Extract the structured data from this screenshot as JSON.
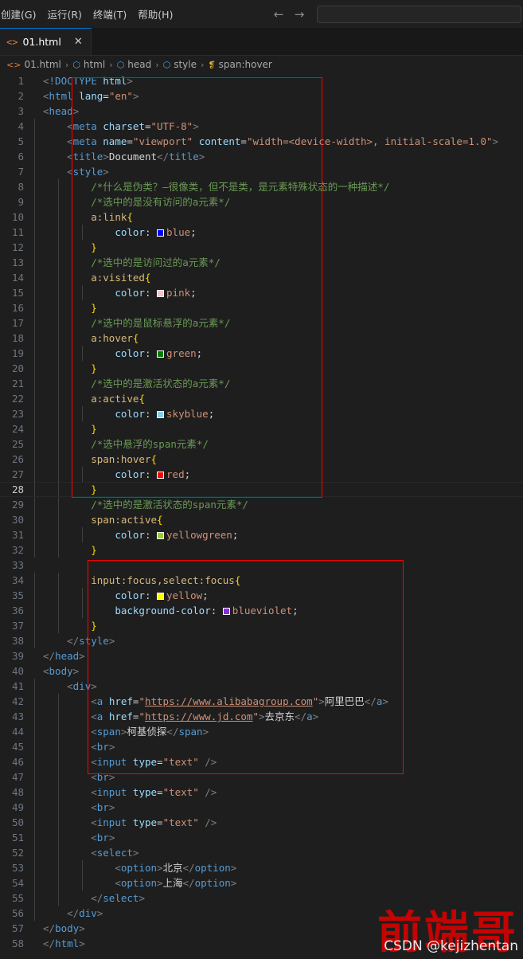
{
  "window": {
    "menu_items": [
      "创建(G)",
      "运行(R)",
      "终端(T)",
      "帮助(H)"
    ],
    "nav_back": "←",
    "nav_forward": "→",
    "search_placeholder": "",
    "search_value": ""
  },
  "tab": {
    "file_icon": "<>",
    "label": "01.html",
    "close": "✕"
  },
  "breadcrumb": {
    "items": [
      {
        "icon": "html-file-icon",
        "glyph": "<>",
        "label": "01.html"
      },
      {
        "icon": "cube-icon",
        "glyph": "⬡",
        "label": "html"
      },
      {
        "icon": "cube-icon",
        "glyph": "⬡",
        "label": "head"
      },
      {
        "icon": "cube-icon",
        "glyph": "⬡",
        "label": "style"
      },
      {
        "icon": "css-rule-icon",
        "glyph": "❡",
        "label": "span:hover"
      }
    ],
    "separator": "›"
  },
  "editor": {
    "active_line": 28,
    "colors": {
      "comment": "#6a9955",
      "tag": "#569cd6",
      "attribute": "#9cdcfe",
      "string": "#ce9178",
      "selector": "#d7ba7d",
      "brace": "#ffd700",
      "annotation_box": "#ff0000",
      "background": "#1e1e1e"
    },
    "lines": [
      {
        "n": 1,
        "text": "<!DOCTYPE html>"
      },
      {
        "n": 2,
        "text": "<html lang=\"en\">"
      },
      {
        "n": 3,
        "text": "<head>"
      },
      {
        "n": 4,
        "text": "    <meta charset=\"UTF-8\">"
      },
      {
        "n": 5,
        "text": "    <meta name=\"viewport\" content=\"width=<device-width>, initial-scale=1.0\">"
      },
      {
        "n": 6,
        "text": "    <title>Document</title>"
      },
      {
        "n": 7,
        "text": "    <style>"
      },
      {
        "n": 8,
        "text": "        /*什么是伪类？—很像类，但不是类，是元素特殊状态的一种描述*/"
      },
      {
        "n": 9,
        "text": "        /*选中的是没有访问的a元素*/"
      },
      {
        "n": 10,
        "text": "        a:link{"
      },
      {
        "n": 11,
        "text": "            color: blue;"
      },
      {
        "n": 12,
        "text": "        }"
      },
      {
        "n": 13,
        "text": "        /*选中的是访问过的a元素*/"
      },
      {
        "n": 14,
        "text": "        a:visited{"
      },
      {
        "n": 15,
        "text": "            color: pink;"
      },
      {
        "n": 16,
        "text": "        }"
      },
      {
        "n": 17,
        "text": "        /*选中的是鼠标悬浮的a元素*/"
      },
      {
        "n": 18,
        "text": "        a:hover{"
      },
      {
        "n": 19,
        "text": "            color: green;"
      },
      {
        "n": 20,
        "text": "        }"
      },
      {
        "n": 21,
        "text": "        /*选中的是激活状态的a元素*/"
      },
      {
        "n": 22,
        "text": "        a:active{"
      },
      {
        "n": 23,
        "text": "            color: skyblue;"
      },
      {
        "n": 24,
        "text": "        }"
      },
      {
        "n": 25,
        "text": "        /*选中悬浮的span元素*/"
      },
      {
        "n": 26,
        "text": "        span:hover{"
      },
      {
        "n": 27,
        "text": "            color: red;"
      },
      {
        "n": 28,
        "text": "        }"
      },
      {
        "n": 29,
        "text": "        /*选中的是激活状态的span元素*/"
      },
      {
        "n": 30,
        "text": "        span:active{"
      },
      {
        "n": 31,
        "text": "            color: yellowgreen;"
      },
      {
        "n": 32,
        "text": "        }"
      },
      {
        "n": 33,
        "text": ""
      },
      {
        "n": 34,
        "text": "        input:focus,select:focus{"
      },
      {
        "n": 35,
        "text": "            color: yellow;"
      },
      {
        "n": 36,
        "text": "            background-color: blueviolet;"
      },
      {
        "n": 37,
        "text": "        }"
      },
      {
        "n": 38,
        "text": "    </style>"
      },
      {
        "n": 39,
        "text": "</head>"
      },
      {
        "n": 40,
        "text": "<body>"
      },
      {
        "n": 41,
        "text": "    <div>"
      },
      {
        "n": 42,
        "text": "        <a href=\"https://www.alibabagroup.com\">阿里巴巴</a>"
      },
      {
        "n": 43,
        "text": "        <a href=\"https://www.jd.com\">去京东</a>"
      },
      {
        "n": 44,
        "text": "        <span>柯基侦探</span>"
      },
      {
        "n": 45,
        "text": "        <br>"
      },
      {
        "n": 46,
        "text": "        <input type=\"text\" />"
      },
      {
        "n": 47,
        "text": "        <br>"
      },
      {
        "n": 48,
        "text": "        <input type=\"text\" />"
      },
      {
        "n": 49,
        "text": "        <br>"
      },
      {
        "n": 50,
        "text": "        <input type=\"text\" />"
      },
      {
        "n": 51,
        "text": "        <br>"
      },
      {
        "n": 52,
        "text": "        <select>"
      },
      {
        "n": 53,
        "text": "            <option>北京</option>"
      },
      {
        "n": 54,
        "text": "            <option>上海</option>"
      },
      {
        "n": 55,
        "text": "        </select>"
      },
      {
        "n": 56,
        "text": "    </div>"
      },
      {
        "n": 57,
        "text": "</body>"
      },
      {
        "n": 58,
        "text": "</html>"
      }
    ],
    "color_swatches": {
      "blue": "#0000ff",
      "pink": "#ffc0cb",
      "green": "#008000",
      "skyblue": "#87ceeb",
      "red": "#ff0000",
      "yellowgreen": "#9acd32",
      "yellow": "#ffff00",
      "blueviolet": "#8a2be2"
    }
  },
  "watermark": {
    "chinese": "前端哥",
    "credit": "CSDN @kejizhentan"
  }
}
